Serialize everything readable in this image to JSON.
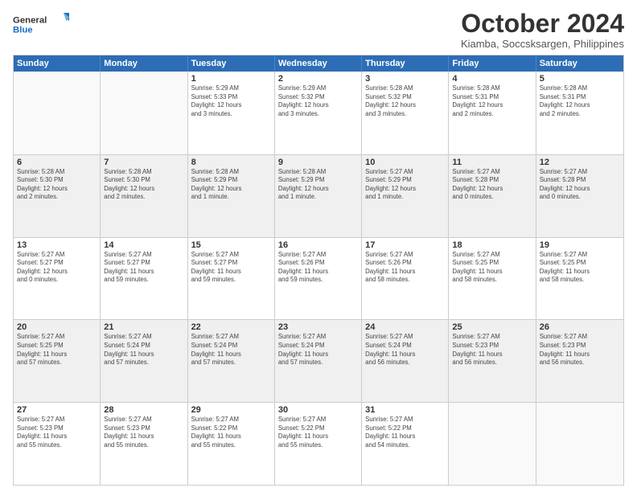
{
  "logo": {
    "line1": "General",
    "line2": "Blue"
  },
  "title": "October 2024",
  "subtitle": "Kiamba, Soccsksargen, Philippines",
  "header_days": [
    "Sunday",
    "Monday",
    "Tuesday",
    "Wednesday",
    "Thursday",
    "Friday",
    "Saturday"
  ],
  "weeks": [
    [
      {
        "day": "",
        "info": ""
      },
      {
        "day": "",
        "info": ""
      },
      {
        "day": "1",
        "info": "Sunrise: 5:29 AM\nSunset: 5:33 PM\nDaylight: 12 hours\nand 3 minutes."
      },
      {
        "day": "2",
        "info": "Sunrise: 5:29 AM\nSunset: 5:32 PM\nDaylight: 12 hours\nand 3 minutes."
      },
      {
        "day": "3",
        "info": "Sunrise: 5:28 AM\nSunset: 5:32 PM\nDaylight: 12 hours\nand 3 minutes."
      },
      {
        "day": "4",
        "info": "Sunrise: 5:28 AM\nSunset: 5:31 PM\nDaylight: 12 hours\nand 2 minutes."
      },
      {
        "day": "5",
        "info": "Sunrise: 5:28 AM\nSunset: 5:31 PM\nDaylight: 12 hours\nand 2 minutes."
      }
    ],
    [
      {
        "day": "6",
        "info": "Sunrise: 5:28 AM\nSunset: 5:30 PM\nDaylight: 12 hours\nand 2 minutes."
      },
      {
        "day": "7",
        "info": "Sunrise: 5:28 AM\nSunset: 5:30 PM\nDaylight: 12 hours\nand 2 minutes."
      },
      {
        "day": "8",
        "info": "Sunrise: 5:28 AM\nSunset: 5:29 PM\nDaylight: 12 hours\nand 1 minute."
      },
      {
        "day": "9",
        "info": "Sunrise: 5:28 AM\nSunset: 5:29 PM\nDaylight: 12 hours\nand 1 minute."
      },
      {
        "day": "10",
        "info": "Sunrise: 5:27 AM\nSunset: 5:29 PM\nDaylight: 12 hours\nand 1 minute."
      },
      {
        "day": "11",
        "info": "Sunrise: 5:27 AM\nSunset: 5:28 PM\nDaylight: 12 hours\nand 0 minutes."
      },
      {
        "day": "12",
        "info": "Sunrise: 5:27 AM\nSunset: 5:28 PM\nDaylight: 12 hours\nand 0 minutes."
      }
    ],
    [
      {
        "day": "13",
        "info": "Sunrise: 5:27 AM\nSunset: 5:27 PM\nDaylight: 12 hours\nand 0 minutes."
      },
      {
        "day": "14",
        "info": "Sunrise: 5:27 AM\nSunset: 5:27 PM\nDaylight: 11 hours\nand 59 minutes."
      },
      {
        "day": "15",
        "info": "Sunrise: 5:27 AM\nSunset: 5:27 PM\nDaylight: 11 hours\nand 59 minutes."
      },
      {
        "day": "16",
        "info": "Sunrise: 5:27 AM\nSunset: 5:26 PM\nDaylight: 11 hours\nand 59 minutes."
      },
      {
        "day": "17",
        "info": "Sunrise: 5:27 AM\nSunset: 5:26 PM\nDaylight: 11 hours\nand 58 minutes."
      },
      {
        "day": "18",
        "info": "Sunrise: 5:27 AM\nSunset: 5:25 PM\nDaylight: 11 hours\nand 58 minutes."
      },
      {
        "day": "19",
        "info": "Sunrise: 5:27 AM\nSunset: 5:25 PM\nDaylight: 11 hours\nand 58 minutes."
      }
    ],
    [
      {
        "day": "20",
        "info": "Sunrise: 5:27 AM\nSunset: 5:25 PM\nDaylight: 11 hours\nand 57 minutes."
      },
      {
        "day": "21",
        "info": "Sunrise: 5:27 AM\nSunset: 5:24 PM\nDaylight: 11 hours\nand 57 minutes."
      },
      {
        "day": "22",
        "info": "Sunrise: 5:27 AM\nSunset: 5:24 PM\nDaylight: 11 hours\nand 57 minutes."
      },
      {
        "day": "23",
        "info": "Sunrise: 5:27 AM\nSunset: 5:24 PM\nDaylight: 11 hours\nand 57 minutes."
      },
      {
        "day": "24",
        "info": "Sunrise: 5:27 AM\nSunset: 5:24 PM\nDaylight: 11 hours\nand 56 minutes."
      },
      {
        "day": "25",
        "info": "Sunrise: 5:27 AM\nSunset: 5:23 PM\nDaylight: 11 hours\nand 56 minutes."
      },
      {
        "day": "26",
        "info": "Sunrise: 5:27 AM\nSunset: 5:23 PM\nDaylight: 11 hours\nand 56 minutes."
      }
    ],
    [
      {
        "day": "27",
        "info": "Sunrise: 5:27 AM\nSunset: 5:23 PM\nDaylight: 11 hours\nand 55 minutes."
      },
      {
        "day": "28",
        "info": "Sunrise: 5:27 AM\nSunset: 5:23 PM\nDaylight: 11 hours\nand 55 minutes."
      },
      {
        "day": "29",
        "info": "Sunrise: 5:27 AM\nSunset: 5:22 PM\nDaylight: 11 hours\nand 55 minutes."
      },
      {
        "day": "30",
        "info": "Sunrise: 5:27 AM\nSunset: 5:22 PM\nDaylight: 11 hours\nand 55 minutes."
      },
      {
        "day": "31",
        "info": "Sunrise: 5:27 AM\nSunset: 5:22 PM\nDaylight: 11 hours\nand 54 minutes."
      },
      {
        "day": "",
        "info": ""
      },
      {
        "day": "",
        "info": ""
      }
    ]
  ]
}
